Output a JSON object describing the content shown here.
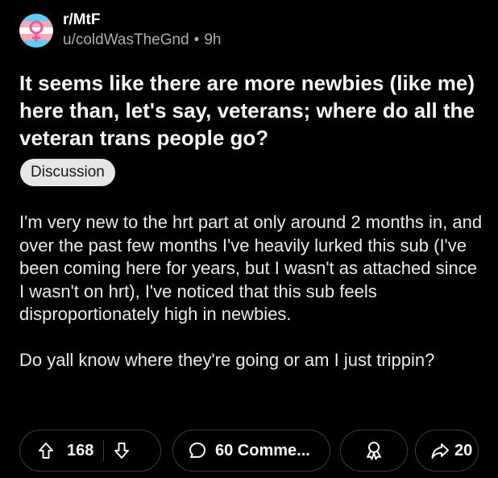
{
  "post": {
    "subreddit": "r/MtF",
    "author": "u/coldWasTheGnd",
    "separator": "•",
    "age": "9h",
    "title": "It seems like there are more newbies (like me) here than, let's say, veterans; where do all the veteran trans people go?",
    "flair": "Discussion",
    "body": [
      "I'm very new to the hrt part at only around 2 months in, and over the past few months I've heavily lurked this sub (I've been coming here for years, but I wasn't as attached since I wasn't on hrt), I've noticed that this sub feels disproportionately high in newbies.",
      "Do yall know where they're going or am I just trippin?"
    ]
  },
  "actions": {
    "upvotes": "168",
    "comments": "60 Comme...",
    "shares": "20"
  },
  "colors": {
    "background": "#000000",
    "text": "#f2f4f5",
    "muted": "#a8aeb3",
    "pill_border": "#3a3d3f",
    "flair_bg": "#e4e6e8",
    "trans_blue": "#5bcefa",
    "trans_pink": "#f5a9b8",
    "emblem_pink": "#e25d9b"
  },
  "icons": {
    "avatar": "trans-pride-venus-emblem",
    "upvote": "arrow-up-outline-icon",
    "downvote": "arrow-down-outline-icon",
    "comment": "speech-bubble-icon",
    "award": "award-medal-icon",
    "share": "share-arrow-icon"
  }
}
